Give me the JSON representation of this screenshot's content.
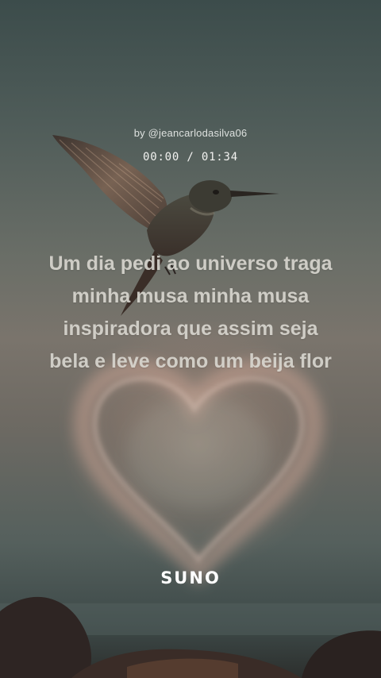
{
  "header": {
    "author": "by @jeancarlodasilva06",
    "time_current": "00:00",
    "time_separator": "/",
    "time_total": "01:34"
  },
  "lyrics": {
    "lines": [
      "Um dia pedi ao universo  traga",
      "minha musa  minha musa",
      "inspiradora  que assim seja",
      "bela e leve como um beija flor"
    ]
  },
  "branding": {
    "logo_text": "SUNO"
  },
  "artwork": {
    "subject": "hummingbird",
    "colors": {
      "sky_top": "#3c4c4b",
      "sky_mid": "#7a746c",
      "heart_glow": "#dcb9a8",
      "rocks": "#2a2522"
    }
  }
}
